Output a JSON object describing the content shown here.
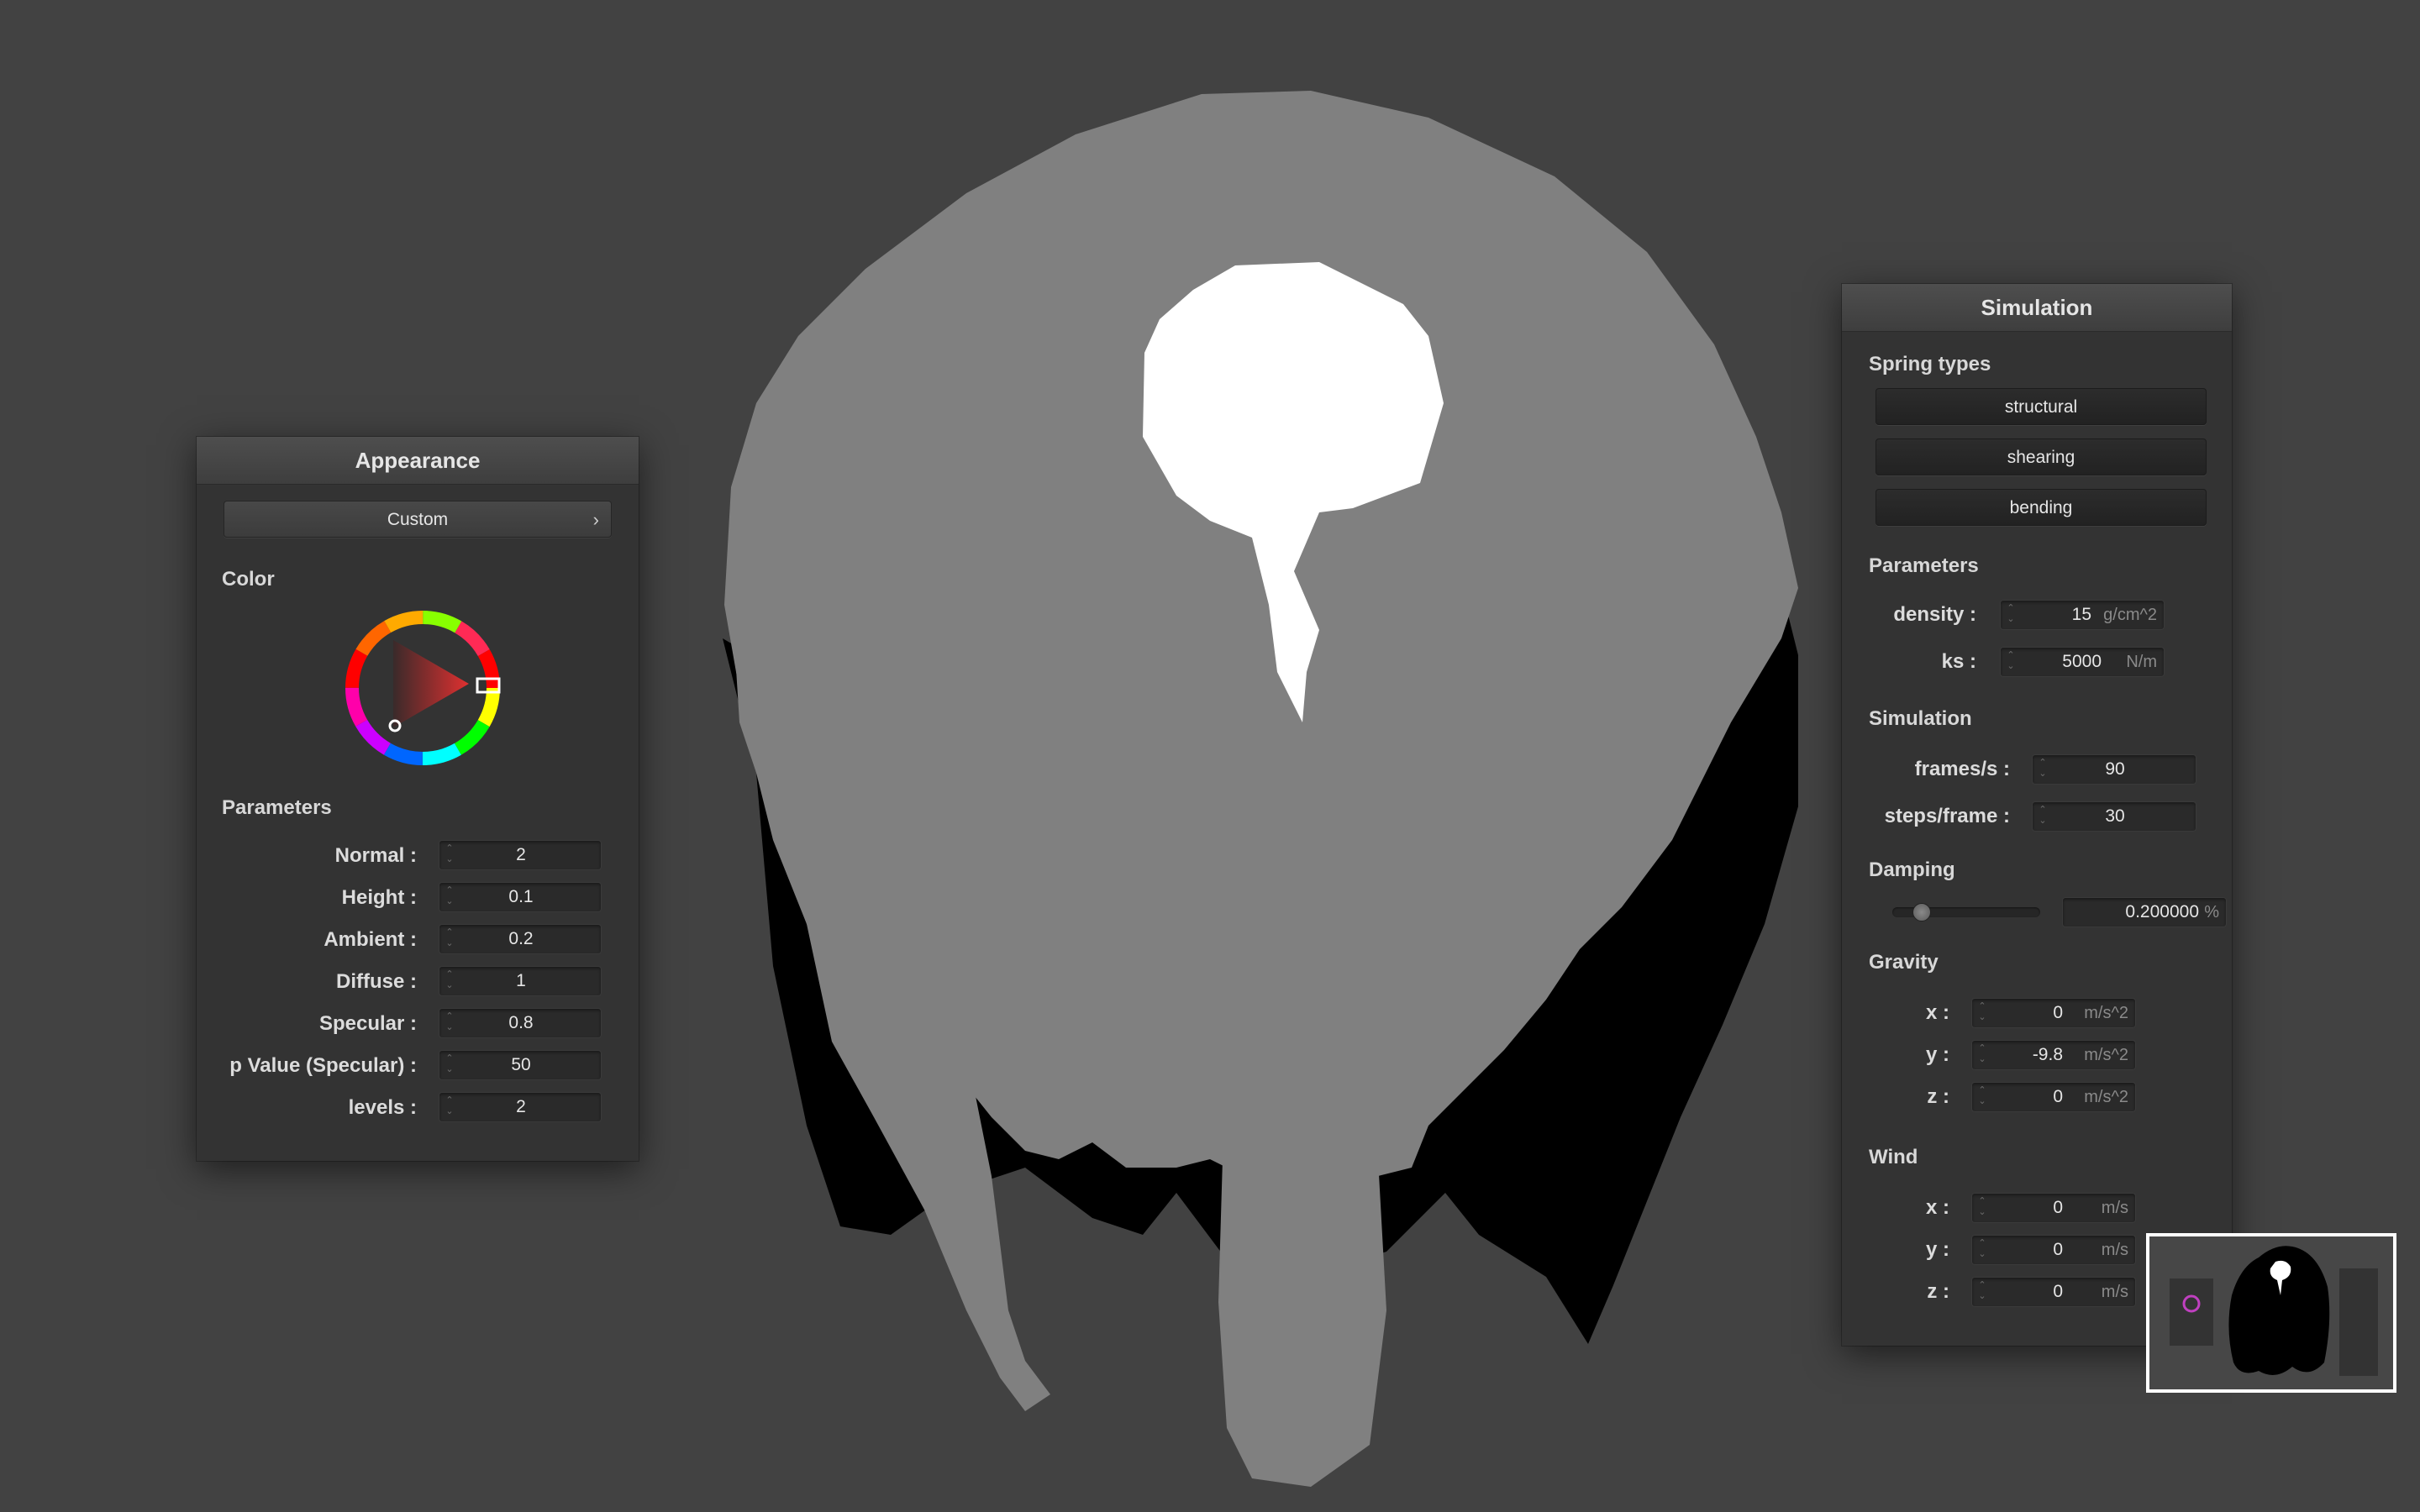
{
  "appearance": {
    "title": "Appearance",
    "preset_label": "Custom",
    "preset_chevron": "›",
    "color_label": "Color",
    "parameters_label": "Parameters",
    "params": [
      {
        "label": "Normal :",
        "value": "2"
      },
      {
        "label": "Height :",
        "value": "0.1"
      },
      {
        "label": "Ambient :",
        "value": "0.2"
      },
      {
        "label": "Diffuse :",
        "value": "1"
      },
      {
        "label": "Specular :",
        "value": "0.8"
      },
      {
        "label": "p Value (Specular) :",
        "value": "50"
      },
      {
        "label": "levels :",
        "value": "2"
      }
    ],
    "picked_color": "#e03030"
  },
  "simulation": {
    "title": "Simulation",
    "spring_types_label": "Spring types",
    "spring_buttons": [
      "structural",
      "shearing",
      "bending"
    ],
    "parameters_label": "Parameters",
    "parameters": [
      {
        "label": "density :",
        "value": "15",
        "unit": "g/cm^2"
      },
      {
        "label": "ks :",
        "value": "5000",
        "unit": "N/m"
      }
    ],
    "simulation_label": "Simulation",
    "sim_fields": [
      {
        "label": "frames/s :",
        "value": "90"
      },
      {
        "label": "steps/frame :",
        "value": "30"
      }
    ],
    "damping_label": "Damping",
    "damping": {
      "value": "0.200000",
      "unit": "%"
    },
    "gravity_label": "Gravity",
    "gravity": [
      {
        "label": "x :",
        "value": "0",
        "unit": "m/s^2"
      },
      {
        "label": "y :",
        "value": "-9.8",
        "unit": "m/s^2"
      },
      {
        "label": "z :",
        "value": "0",
        "unit": "m/s^2"
      }
    ],
    "wind_label": "Wind",
    "wind": [
      {
        "label": "x :",
        "value": "0",
        "unit": "m/s"
      },
      {
        "label": "y :",
        "value": "0",
        "unit": "m/s"
      },
      {
        "label": "z :",
        "value": "0",
        "unit": "m/s"
      }
    ]
  },
  "colors": {
    "background": "#424242",
    "panel": "#333333",
    "cloth_light": "#808080",
    "cloth_dark": "#000000",
    "highlight": "#ffffff"
  }
}
